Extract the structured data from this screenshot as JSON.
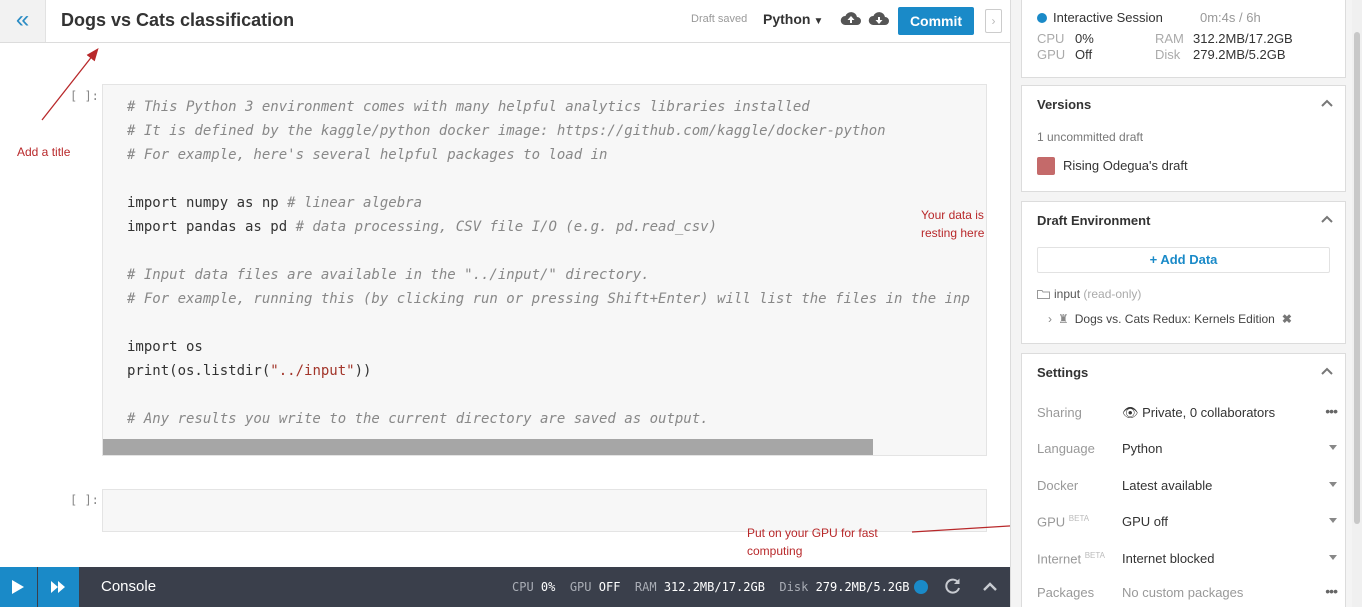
{
  "header": {
    "collapse_glyph": "«",
    "title": "Dogs vs Cats classification",
    "draft_status": "Draft saved",
    "language": "Python",
    "commit_label": "Commit"
  },
  "editor": {
    "cell1_prompt": "[ ]:",
    "cell2_prompt": "[ ]:",
    "code_lines": [
      "# This Python 3 environment comes with many helpful analytics libraries installed",
      "# It is defined by the kaggle/python docker image: https://github.com/kaggle/docker-python",
      "# For example, here's several helpful packages to load in",
      "",
      "import numpy as np # linear algebra",
      "import pandas as pd # data processing, CSV file I/O (e.g. pd.read_csv)",
      "",
      "# Input data files are available in the \"../input/\" directory.",
      "# For example, running this (by clicking run or pressing Shift+Enter) will list the files in the inp",
      "",
      "import os",
      "print(os.listdir(\"../input\"))",
      "",
      "# Any results you write to the current directory are saved as output."
    ]
  },
  "annotations": {
    "title_note": "Add a title",
    "data_note_line1": "Your data is",
    "data_note_line2": "resting here",
    "gpu_note_line1": "Put on your GPU for fast",
    "gpu_note_line2": "computing"
  },
  "console": {
    "label": "Console",
    "cpu_label": "CPU",
    "cpu_value": "0%",
    "gpu_label": "GPU",
    "gpu_value": "OFF",
    "ram_label": "RAM",
    "ram_value": "312.2MB/17.2GB",
    "disk_label": "Disk",
    "disk_value": "279.2MB/5.2GB"
  },
  "session": {
    "label": "Interactive Session",
    "time": "0m:4s / 6h",
    "cpu_label": "CPU",
    "cpu_value": "0%",
    "gpu_label": "GPU",
    "gpu_value": "Off",
    "ram_label": "RAM",
    "ram_value": "312.2MB/17.2GB",
    "disk_label": "Disk",
    "disk_value": "279.2MB/5.2GB"
  },
  "versions": {
    "heading": "Versions",
    "uncommitted": "1 uncommitted draft",
    "draft_name": "Rising Odegua's draft"
  },
  "draft_env": {
    "heading": "Draft Environment",
    "add_data": "Add Data",
    "input_label": "input",
    "input_readonly": "(read-only)",
    "dataset": "Dogs vs. Cats Redux: Kernels Edition"
  },
  "settings": {
    "heading": "Settings",
    "rows": [
      {
        "key": "Sharing",
        "beta": "",
        "value": "Private, 0 collaborators"
      },
      {
        "key": "Language",
        "beta": "",
        "value": "Python"
      },
      {
        "key": "Docker",
        "beta": "",
        "value": "Latest available"
      },
      {
        "key": "GPU",
        "beta": "BETA",
        "value": "GPU off"
      },
      {
        "key": "Internet",
        "beta": "BETA",
        "value": "Internet blocked"
      },
      {
        "key": "Packages",
        "beta": "",
        "value": "No custom packages"
      }
    ]
  },
  "colors": {
    "accent": "#1a8ac8",
    "annotation": "#b8282a",
    "console_bg": "#3a3f4b"
  },
  "icons": [
    "double-chevron-left-icon",
    "cloud-upload-icon",
    "cloud-download-icon",
    "chevron-right-icon",
    "play-icon",
    "fast-forward-icon",
    "status-dot-icon",
    "refresh-icon",
    "chevron-up-icon",
    "eye-icon",
    "folder-icon",
    "trophy-icon",
    "close-icon",
    "more-icon",
    "dropdown-caret-icon"
  ]
}
